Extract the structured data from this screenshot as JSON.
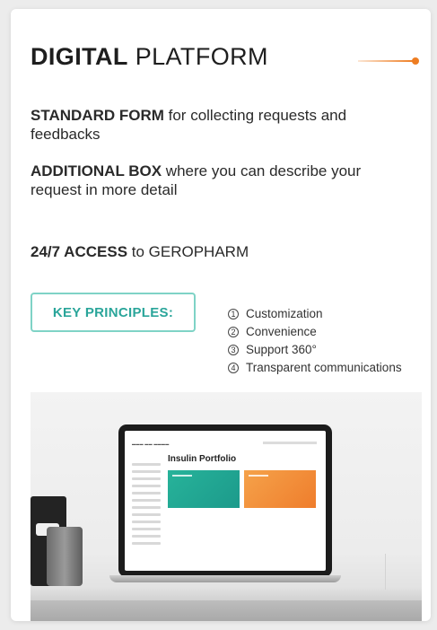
{
  "header": {
    "title_bold": "DIGITAL",
    "title_light": "PLATFORM",
    "accent_color": "#ee7d22"
  },
  "features": [
    {
      "bold": "STANDARD FORM",
      "text": " for collecting requests and feedbacks"
    },
    {
      "bold": "ADDITIONAL BOX",
      "text": " where you can describe your request in more detail"
    },
    {
      "bold": "24/7 ACCESS",
      "text": " to GEROPHARM"
    }
  ],
  "key_principles": {
    "label": "KEY PRINCIPLES:",
    "border_color": "#7fd3c6",
    "items": [
      {
        "num": "1",
        "text": "Customization"
      },
      {
        "num": "2",
        "text": "Convenience"
      },
      {
        "num": "3",
        "text": "Support 360°"
      },
      {
        "num": "4",
        "text": "Transparent communications"
      }
    ]
  },
  "photo": {
    "screen_title": "Insulin Portfolio",
    "tile_colors": [
      "#1c9a8b",
      "#ef7d2c"
    ]
  }
}
